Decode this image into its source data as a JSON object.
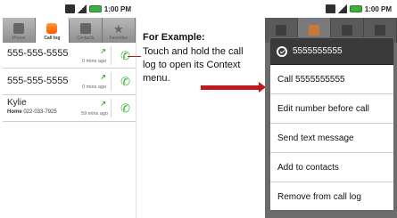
{
  "left_phone": {
    "status_time": "1:00 PM",
    "tabs": [
      {
        "label": "Phone",
        "icon": "phone-icon",
        "active": false
      },
      {
        "label": "Call log",
        "icon": "call-log-icon",
        "active": true
      },
      {
        "label": "Contacts",
        "icon": "contacts-icon",
        "active": false
      },
      {
        "label": "Favorites",
        "icon": "star-icon",
        "active": false
      }
    ],
    "calls": [
      {
        "number": "555-555-5555",
        "time": "0 mins ago"
      },
      {
        "number": "555-555-5555",
        "time": "0 mins ago"
      },
      {
        "name": "Kylie",
        "type": "Home",
        "number": "022-033-7925",
        "time": "59 mins ago"
      }
    ]
  },
  "caption": {
    "title": "For Example:",
    "body": "Touch and hold the call log to open its Context menu."
  },
  "right_phone": {
    "status_time": "1:00 PM",
    "tab_labels": [
      "",
      "Call log",
      "",
      ""
    ],
    "context_menu": {
      "title": "5555555555",
      "items": [
        "Call 5555555555",
        "Edit number before call",
        "Send text message",
        "Add to contacts",
        "Remove from call log"
      ]
    }
  },
  "colors": {
    "accent_red": "#c0181f",
    "call_green": "#2db52d",
    "tab_orange": "#ff7a1a",
    "menu_header": "#3a3a3a"
  }
}
